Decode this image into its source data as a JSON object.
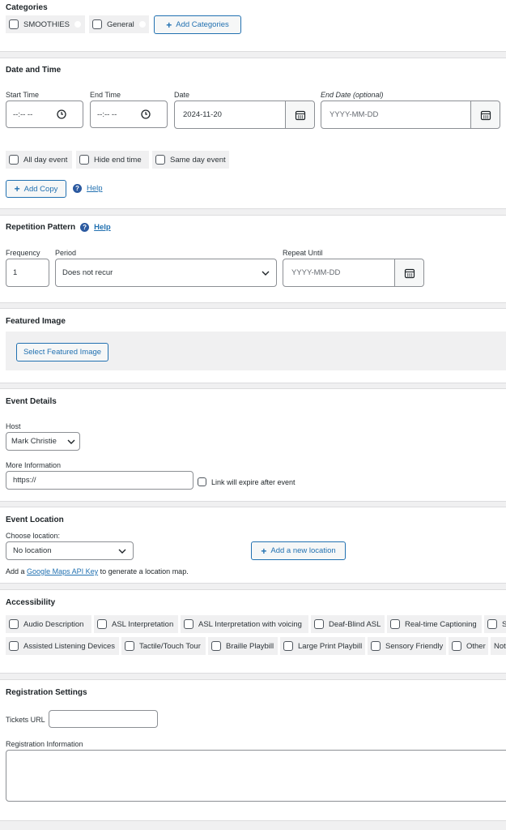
{
  "categories": {
    "heading": "Categories",
    "items": [
      {
        "label": "SMOOTHIES"
      },
      {
        "label": "General"
      }
    ],
    "add_button": "Add Categories"
  },
  "datetime": {
    "heading": "Date and Time",
    "start_label": "Start Time",
    "end_label": "End Time",
    "date_label": "Date",
    "end_date_label": "End Date (optional)",
    "start_value": "--:-- --",
    "end_value": "--:-- --",
    "date_value": "2024-11-20",
    "end_date_placeholder": "YYYY-MM-DD",
    "options": [
      "All day event",
      "Hide end time",
      "Same day event"
    ],
    "add_copy": "Add Copy",
    "help": "Help"
  },
  "repetition": {
    "heading": "Repetition Pattern",
    "help": "Help",
    "frequency_label": "Frequency",
    "frequency_value": "1",
    "period_label": "Period",
    "period_value": "Does not recur",
    "repeat_label": "Repeat Until",
    "repeat_placeholder": "YYYY-MM-DD"
  },
  "featured": {
    "heading": "Featured Image",
    "button": "Select Featured Image"
  },
  "event_details": {
    "heading": "Event Details",
    "host_label": "Host",
    "host_value": "Mark Christie",
    "more_info_label": "More Information",
    "more_info_value": "https://",
    "expire_label": "Link will expire after event"
  },
  "location": {
    "heading": "Event Location",
    "choose_label": "Choose location:",
    "select_value": "No location",
    "add_button": "Add a new location",
    "note_prefix": "Add a",
    "note_link": "Google Maps API Key",
    "note_suffix": "to generate a location map."
  },
  "accessibility": {
    "heading": "Accessibility",
    "row1": [
      "Audio Description",
      "ASL Interpretation",
      "ASL Interpretation with voicing",
      "Deaf-Blind ASL",
      "Real-time Captioning",
      "S"
    ],
    "row2": [
      "Assisted Listening Devices",
      "Tactile/Touch Tour",
      "Braille Playbill",
      "Large Print Playbill",
      "Sensory Friendly",
      "Other",
      "Not"
    ]
  },
  "registration": {
    "heading": "Registration Settings",
    "tickets_label": "Tickets URL",
    "info_label": "Registration Information"
  },
  "colors": {
    "accent": "#2271b1",
    "page_bg": "#f0f0f1"
  }
}
